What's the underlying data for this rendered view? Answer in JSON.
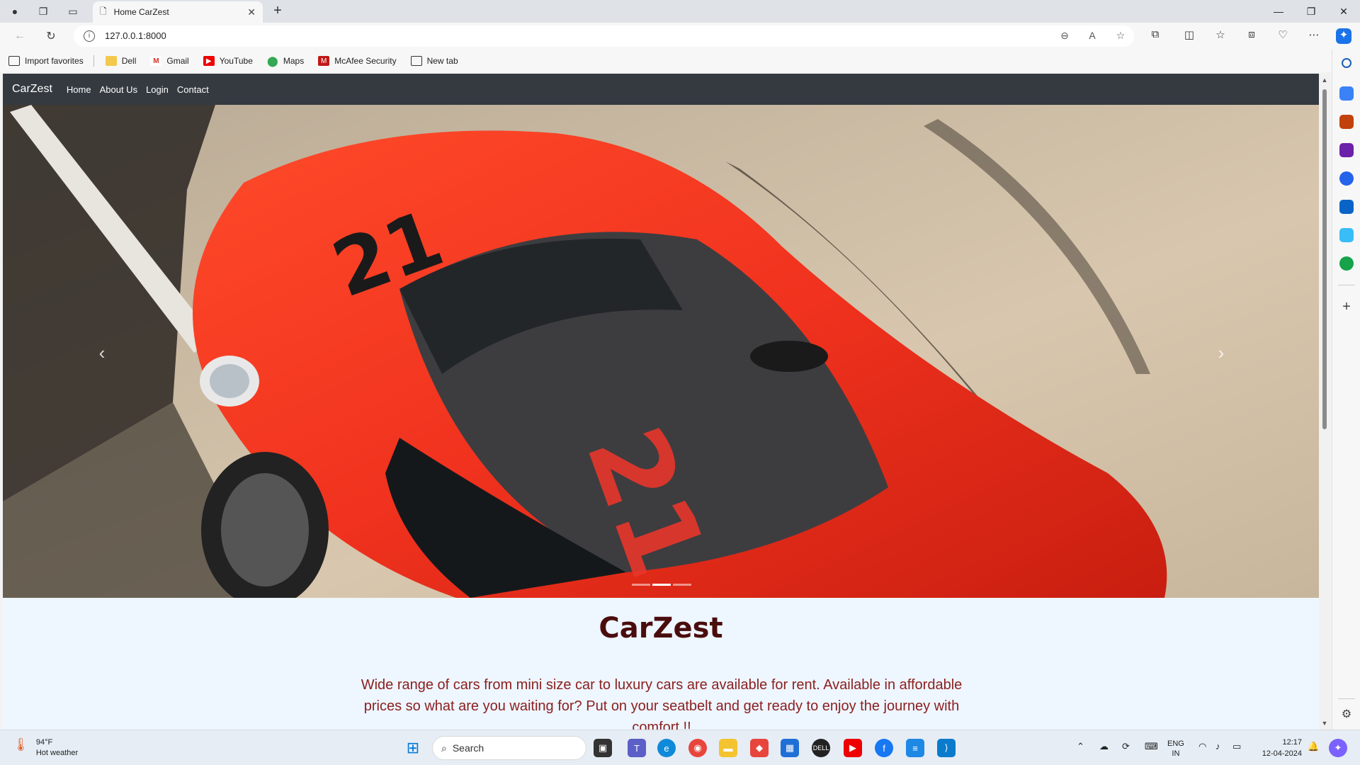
{
  "browser": {
    "tab_title": "Home CarZest",
    "url": "127.0.0.1:8000",
    "favorites": [
      {
        "label": "Import favorites",
        "icon": "import-icon"
      },
      {
        "label": "Dell",
        "icon": "folder-icon"
      },
      {
        "label": "Gmail",
        "icon": "gmail-icon"
      },
      {
        "label": "YouTube",
        "icon": "youtube-icon"
      },
      {
        "label": "Maps",
        "icon": "maps-icon"
      },
      {
        "label": "McAfee Security",
        "icon": "mcafee-icon"
      },
      {
        "label": "New tab",
        "icon": "newtab-icon"
      }
    ]
  },
  "site": {
    "brand": "CarZest",
    "nav": [
      "Home",
      "About Us",
      "Login",
      "Contact"
    ],
    "carousel": {
      "slides": 3,
      "active_index": 1
    },
    "hero_title": "CarZest",
    "hero_text": "Wide range of cars from mini size car to luxury cars are available for rent. Available in affordable prices so what are you waiting for? Put on your seatbelt and get ready to enjoy the journey with comfort !!"
  },
  "taskbar": {
    "weather_temp": "94°F",
    "weather_desc": "Hot weather",
    "search_placeholder": "Search",
    "lang_top": "ENG",
    "lang_bottom": "IN",
    "time": "12:17",
    "date": "12-04-2024"
  },
  "colors": {
    "site_nav_bg": "#343a40",
    "hero_title": "#4a0d0d",
    "hero_text": "#8b2020",
    "page_bg": "#eef6ff",
    "car_red": "#f0321e"
  }
}
